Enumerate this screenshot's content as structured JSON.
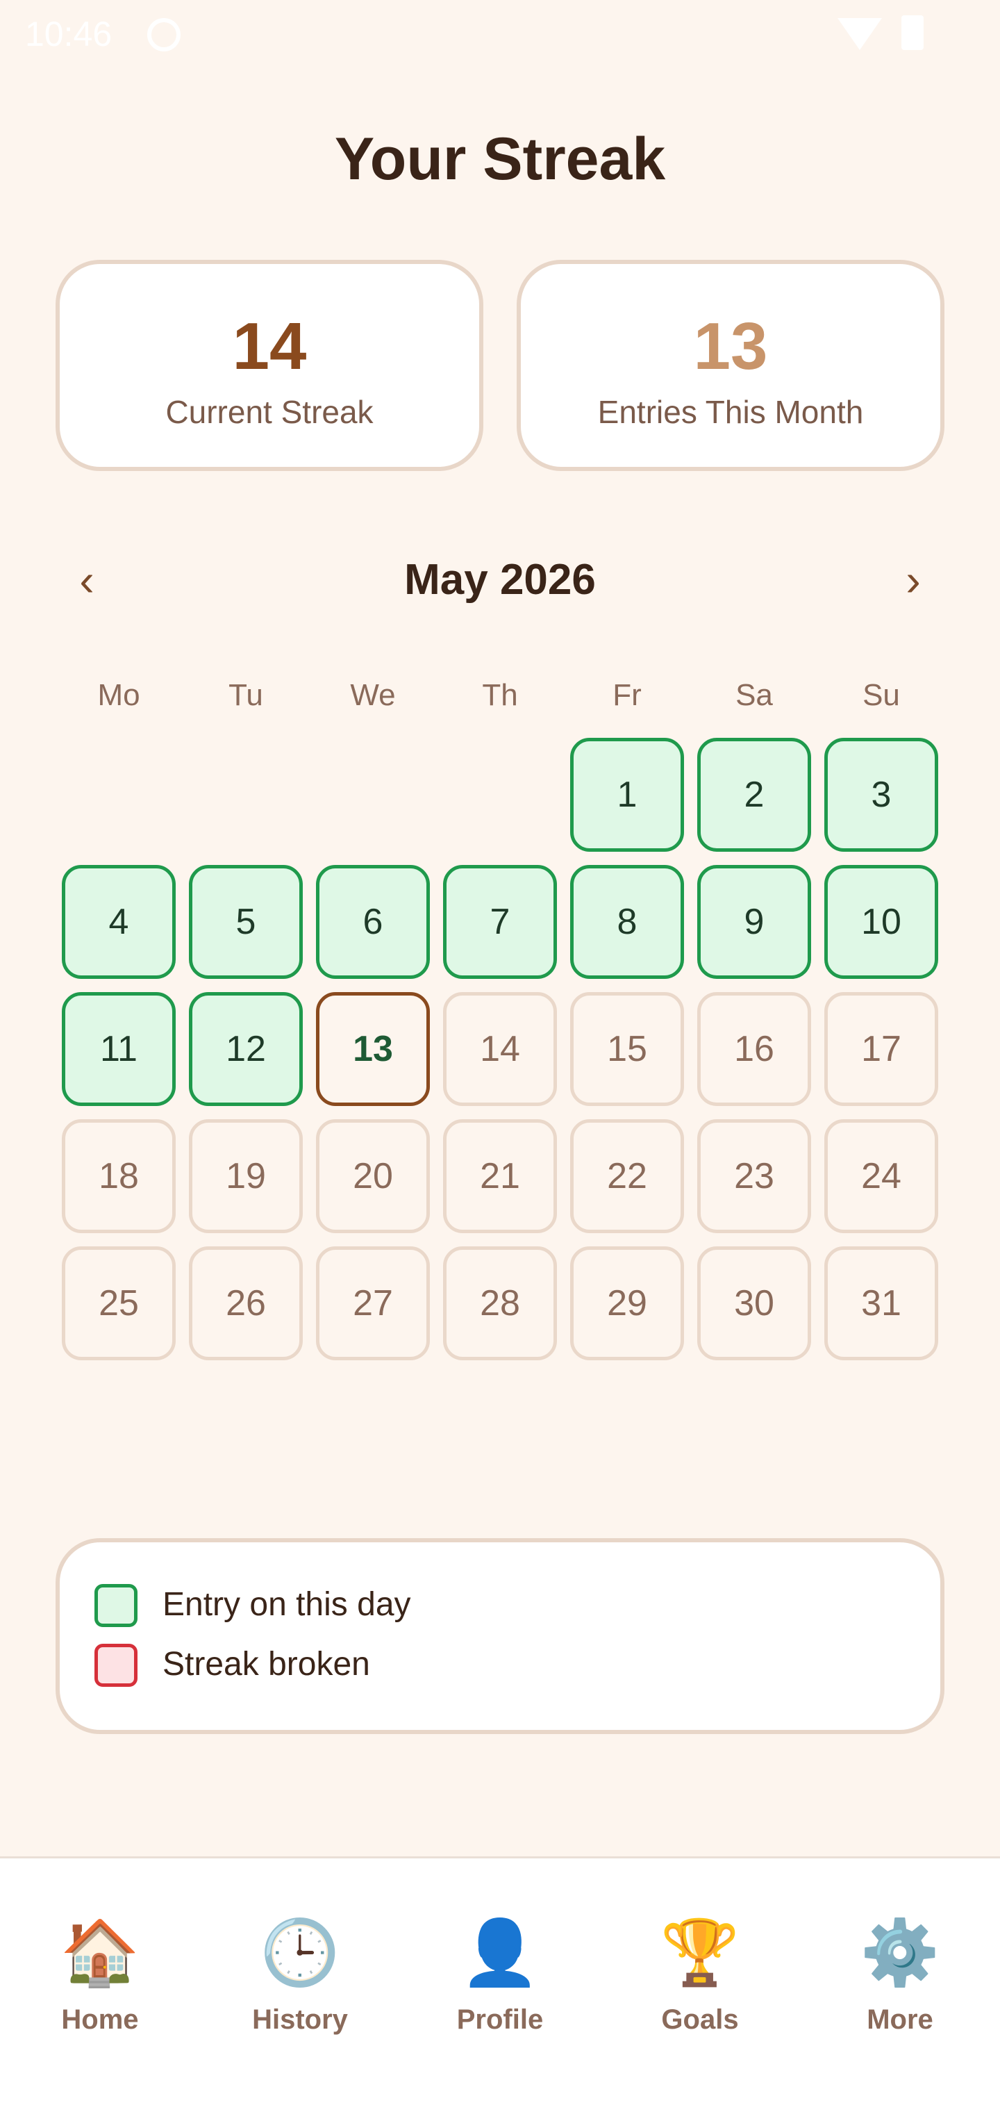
{
  "status_bar": {
    "time": "10:46"
  },
  "page_title": "Your Streak",
  "stats": [
    {
      "value": "14",
      "label": "Current Streak",
      "color": "#8a4a1e"
    },
    {
      "value": "13",
      "label": "Entries This Month",
      "color": "#c8946a"
    }
  ],
  "calendar": {
    "month_title": "May 2026",
    "prev_label": "‹",
    "next_label": "›",
    "weekdays": [
      "Mo",
      "Tu",
      "We",
      "Th",
      "Fr",
      "Sa",
      "Su"
    ],
    "days": [
      {
        "label": "1",
        "state": "entry"
      },
      {
        "label": "2",
        "state": "entry"
      },
      {
        "label": "3",
        "state": "entry"
      },
      {
        "label": "4",
        "state": "entry"
      },
      {
        "label": "5",
        "state": "entry"
      },
      {
        "label": "6",
        "state": "entry"
      },
      {
        "label": "7",
        "state": "entry"
      },
      {
        "label": "8",
        "state": "entry"
      },
      {
        "label": "9",
        "state": "entry"
      },
      {
        "label": "10",
        "state": "entry"
      },
      {
        "label": "11",
        "state": "entry"
      },
      {
        "label": "12",
        "state": "entry"
      },
      {
        "label": "13",
        "state": "today"
      },
      {
        "label": "14",
        "state": "empty"
      },
      {
        "label": "15",
        "state": "empty"
      },
      {
        "label": "16",
        "state": "empty"
      },
      {
        "label": "17",
        "state": "empty"
      },
      {
        "label": "18",
        "state": "empty"
      },
      {
        "label": "19",
        "state": "empty"
      },
      {
        "label": "20",
        "state": "empty"
      },
      {
        "label": "21",
        "state": "empty"
      },
      {
        "label": "22",
        "state": "empty"
      },
      {
        "label": "23",
        "state": "empty"
      },
      {
        "label": "24",
        "state": "empty"
      },
      {
        "label": "25",
        "state": "empty"
      },
      {
        "label": "26",
        "state": "empty"
      },
      {
        "label": "27",
        "state": "empty"
      },
      {
        "label": "28",
        "state": "empty"
      },
      {
        "label": "29",
        "state": "empty"
      },
      {
        "label": "30",
        "state": "empty"
      },
      {
        "label": "31",
        "state": "empty"
      }
    ]
  },
  "legend": [
    {
      "label": "Entry on this day",
      "type": "entry"
    },
    {
      "label": "Streak broken",
      "type": "broken"
    }
  ],
  "nav": [
    {
      "label": "Home",
      "icon": "🏠",
      "icon_name": "home-icon"
    },
    {
      "label": "History",
      "icon": "🕒",
      "icon_name": "clock-icon"
    },
    {
      "label": "Profile",
      "icon": "👤",
      "icon_name": "profile-icon"
    },
    {
      "label": "Goals",
      "icon": "🏆",
      "icon_name": "trophy-icon"
    },
    {
      "label": "More",
      "icon": "⚙️",
      "icon_name": "gear-icon"
    }
  ]
}
